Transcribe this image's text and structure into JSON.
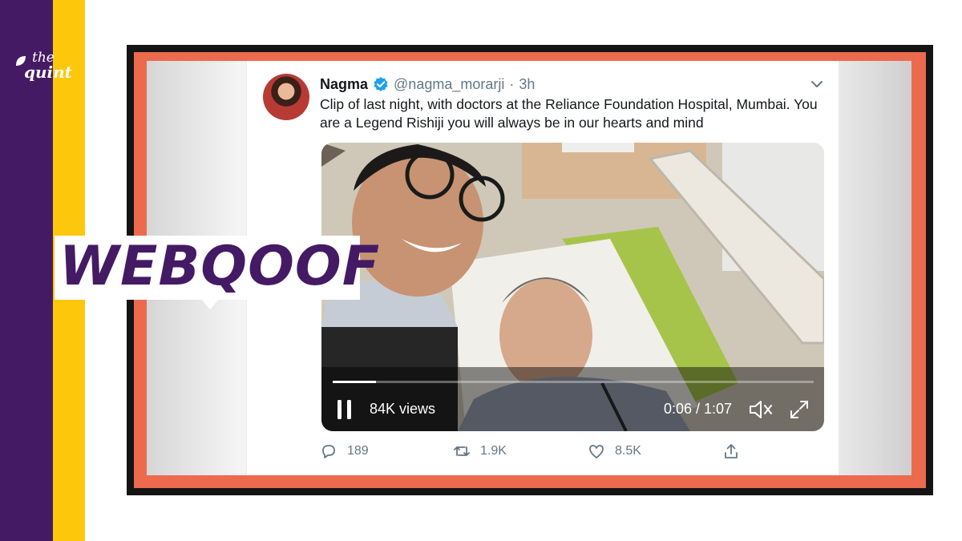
{
  "brand": {
    "logo_line1": "the",
    "logo_line2": "quint",
    "purple": "#451a64",
    "yellow": "#fdc70c"
  },
  "stamp": {
    "label": "WEBQOOF"
  },
  "frame": {
    "border_color": "#141414",
    "accent_color": "#ec6a4d"
  },
  "tweet": {
    "author_name": "Nagma",
    "verified": true,
    "handle": "@nagma_morarji",
    "separator": "·",
    "time_ago": "3h",
    "text": "Clip of last night, with doctors at the Reliance Foundation Hospital, Mumbai. You are a Legend Rishiji you will always be in our hearts and mind",
    "video": {
      "views": "84K views",
      "time": "0:06 / 1:07",
      "progress": 0.09
    },
    "actions": {
      "replies": "189",
      "retweets": "1.9K",
      "likes": "8.5K"
    },
    "icons": [
      "verified-badge-icon",
      "chevron-down-icon",
      "pause-icon",
      "mute-icon",
      "fullscreen-icon",
      "reply-icon",
      "retweet-icon",
      "like-icon",
      "share-icon"
    ]
  }
}
